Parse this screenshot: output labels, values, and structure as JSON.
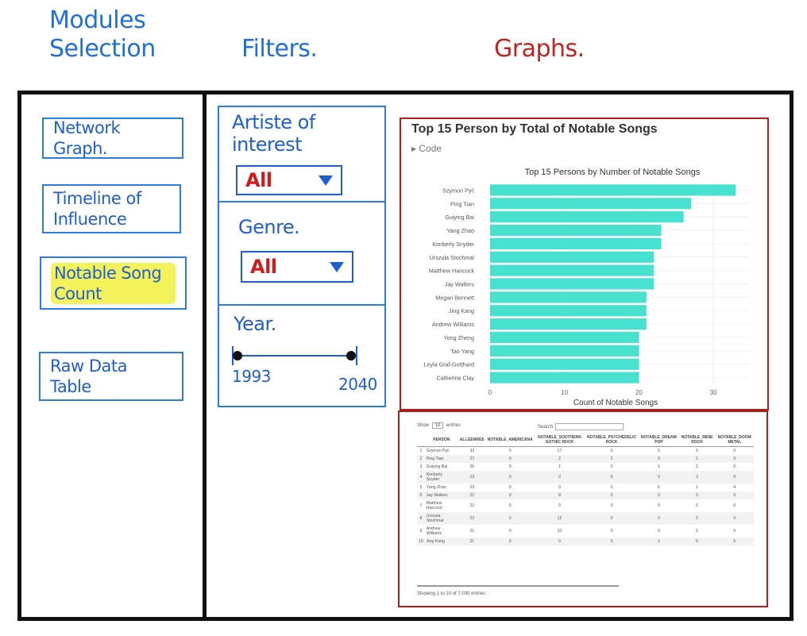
{
  "headers": {
    "modules": [
      "Modules",
      "Selection"
    ],
    "filters": "Filters.",
    "graphs": "Graphs."
  },
  "modules": [
    {
      "label": "Network Graph.",
      "highlighted": false
    },
    {
      "label": "Timeline of Influence",
      "highlighted": false
    },
    {
      "label": "Notable Song Count",
      "highlighted": true
    },
    {
      "label": "Raw Data Table",
      "highlighted": false
    }
  ],
  "filters": {
    "artist": {
      "label": "Artiste of interest",
      "value": "All"
    },
    "genre": {
      "label": "Genre.",
      "value": "All"
    },
    "year": {
      "label": "Year.",
      "min": "1993",
      "max": "2040"
    }
  },
  "chart_section": {
    "title": "Top 15 Person by Total of Notable Songs",
    "code_toggle": "▸ Code"
  },
  "chart_data": {
    "type": "bar",
    "orientation": "horizontal",
    "title": "Top 15 Persons by Number of Notable Songs",
    "xlabel": "Count of Notable Songs",
    "ylabel": "",
    "xlim": [
      0,
      35
    ],
    "xticks": [
      "0",
      "10",
      "20",
      "30"
    ],
    "bar_color": "#48e0cf",
    "grid": true,
    "categories": [
      "Szymon Pyć",
      "Ping Tian",
      "Guiying Bai",
      "Yang Zhao",
      "Kimberly Snyder",
      "Urszula Stochmal",
      "Matthew Hancock",
      "Jay Walters",
      "Megan Bennett",
      "Jing Kang",
      "Andrew Williams",
      "Yong Zheng",
      "Tao Yang",
      "Leyla Graf-Gotthard",
      "Catherine Clay"
    ],
    "values": [
      33,
      27,
      26,
      23,
      23,
      22,
      22,
      22,
      21,
      21,
      21,
      20,
      20,
      20,
      20
    ]
  },
  "table": {
    "show_label": "Show",
    "entries_value": "10",
    "entries_label": "entries",
    "search_label": "Search:",
    "columns": [
      "",
      "PERSON",
      "ALLGENRES",
      "NOTABLE_AMERICANA",
      "NOTABLE_SOUTHERN GOTHIC ROCK",
      "NOTABLE_PSYCHEDELIC ROCK",
      "NOTABLE_DREAM POP",
      "NOTABLE_INDIE ROCK",
      "NOTABLE_DOOM METAL"
    ],
    "rows": [
      [
        "1",
        "Szymon Pyć",
        "33",
        "0",
        "17",
        "0",
        "0",
        "0",
        "0"
      ],
      [
        "2",
        "Ping Tian",
        "27",
        "0",
        "2",
        "2",
        "0",
        "2",
        "0"
      ],
      [
        "3",
        "Guiying Bai",
        "26",
        "0",
        "1",
        "0",
        "1",
        "2",
        "0"
      ],
      [
        "4",
        "Kimberly Snyder",
        "23",
        "0",
        "0",
        "0",
        "0",
        "2",
        "0"
      ],
      [
        "5",
        "Yang Zhao",
        "23",
        "0",
        "0",
        "0",
        "5",
        "1",
        "4"
      ],
      [
        "6",
        "Jay Walters",
        "22",
        "0",
        "8",
        "0",
        "0",
        "0",
        "0"
      ],
      [
        "7",
        "Matthew Hancock",
        "22",
        "0",
        "0",
        "0",
        "0",
        "0",
        "0"
      ],
      [
        "8",
        "Urszula Stochmal",
        "22",
        "0",
        "12",
        "0",
        "0",
        "0",
        "0"
      ],
      [
        "9",
        "Andrew Williams",
        "21",
        "0",
        "10",
        "0",
        "0",
        "0",
        "0"
      ],
      [
        "10",
        "Jing Kang",
        "21",
        "0",
        "0",
        "0",
        "1",
        "5",
        "5"
      ]
    ],
    "footer": "Showing 1 to 10 of 7,030 entries"
  }
}
